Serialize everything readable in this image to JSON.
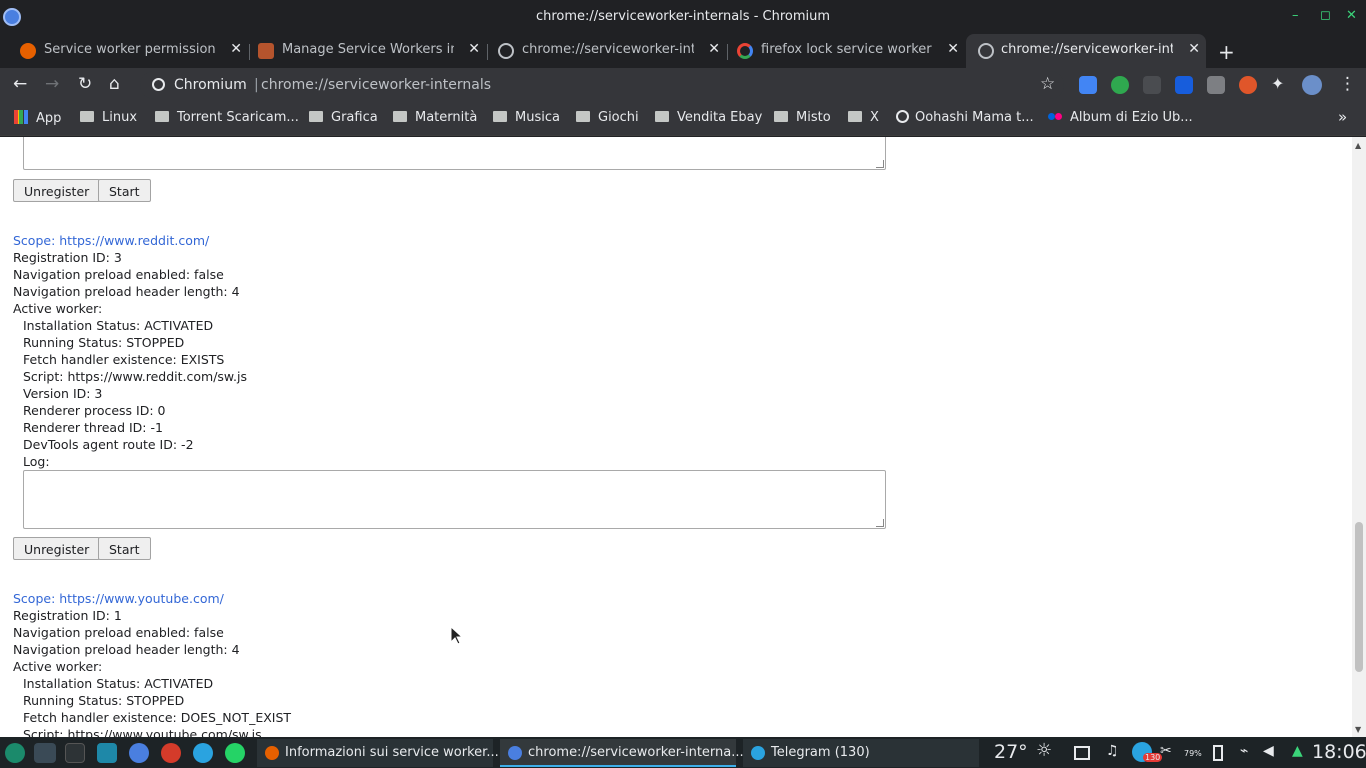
{
  "window": {
    "title": "chrome://serviceworker-internals - Chromium",
    "minimize_glyph": "–",
    "maximize_glyph": "◻",
    "close_glyph": "✕"
  },
  "tabs": [
    {
      "label": "Service worker permissions",
      "favicon": "firefox-icon",
      "color": "#e66000"
    },
    {
      "label": "Manage Service Workers in F",
      "favicon": "page-icon",
      "color": "#b5542d"
    },
    {
      "label": "chrome://serviceworker-inte",
      "favicon": "globe-icon",
      "color": "#bdc1c6"
    },
    {
      "label": "firefox lock service worker - G",
      "favicon": "google-icon",
      "color": "#ea4335"
    },
    {
      "label": "chrome://serviceworker-inte",
      "favicon": "globe-icon",
      "color": "#bdc1c6",
      "active": true
    }
  ],
  "tab_close_glyph": "✕",
  "new_tab_glyph": "+",
  "toolbar": {
    "back": "←",
    "forward": "→",
    "reload": "↻",
    "home": "⌂",
    "site_label": "Chromium",
    "divider": "|",
    "url": "chrome://serviceworker-internals",
    "star": "☆",
    "menu": "⋮"
  },
  "bookmarks": [
    {
      "label": "App",
      "type": "apps"
    },
    {
      "label": "Linux",
      "type": "folder"
    },
    {
      "label": "Torrent Scaricam...",
      "type": "folder"
    },
    {
      "label": "Grafica",
      "type": "folder"
    },
    {
      "label": "Maternità",
      "type": "folder"
    },
    {
      "label": "Musica",
      "type": "folder"
    },
    {
      "label": "Giochi",
      "type": "folder"
    },
    {
      "label": "Vendita Ebay",
      "type": "folder"
    },
    {
      "label": "Misto",
      "type": "folder"
    },
    {
      "label": "X",
      "type": "folder"
    },
    {
      "label": "Oohashi Mama t...",
      "type": "site"
    },
    {
      "label": "Album di Ezio Ub...",
      "type": "flickr"
    }
  ],
  "bookmarks_overflow": "»",
  "page": {
    "buttons": {
      "unregister": "Unregister",
      "start": "Start"
    },
    "reddit": {
      "scope": "Scope: https://www.reddit.com/",
      "registration_id": "Registration ID: 3",
      "nav_preload_enabled": "Navigation preload enabled: false",
      "nav_preload_header_length": "Navigation preload header length: 4",
      "active_worker": "Active worker:",
      "installation_status": "Installation Status: ACTIVATED",
      "running_status": "Running Status: STOPPED",
      "fetch_handler": "Fetch handler existence: EXISTS",
      "script": "Script: https://www.reddit.com/sw.js",
      "version_id": "Version ID: 3",
      "renderer_process_id": "Renderer process ID: 0",
      "renderer_thread_id": "Renderer thread ID: -1",
      "devtools_route_id": "DevTools agent route ID: -2",
      "log": "Log:"
    },
    "youtube": {
      "scope": "Scope: https://www.youtube.com/",
      "registration_id": "Registration ID: 1",
      "nav_preload_enabled": "Navigation preload enabled: false",
      "nav_preload_header_length": "Navigation preload header length: 4",
      "active_worker": "Active worker:",
      "installation_status": "Installation Status: ACTIVATED",
      "running_status": "Running Status: STOPPED",
      "fetch_handler": "Fetch handler existence: DOES_NOT_EXIST",
      "script": "Script: https://www.youtube.com/sw.js"
    }
  },
  "taskbar": {
    "tasks": [
      {
        "label": "Informazioni sui service worker...",
        "icon_color": "#e66000"
      },
      {
        "label": "chrome://serviceworker-interna...",
        "icon_color": "#4a7fe0",
        "active": true
      },
      {
        "label": "Telegram (130)",
        "icon_color": "#2aa3e0"
      }
    ],
    "temperature": "27°",
    "telegram_badge": "130",
    "battery": "79%",
    "clock": "18:06"
  },
  "colors": {
    "link": "#3367d6",
    "chrome_dark": "#202124",
    "toolbar": "#35363a",
    "taskbar": "#1d2326",
    "accent_green": "#3bd47a"
  }
}
